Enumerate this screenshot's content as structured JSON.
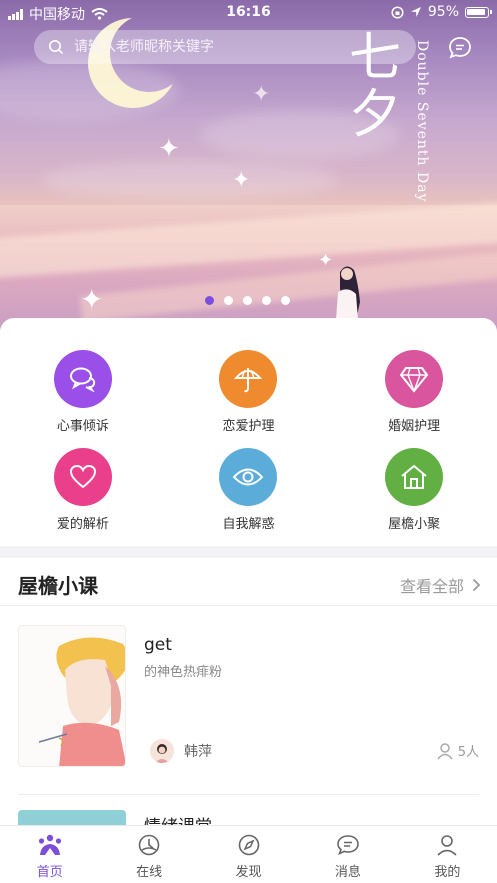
{
  "status_bar": {
    "carrier": "中国移动",
    "time": "16:16",
    "battery": "95%"
  },
  "search": {
    "placeholder": "请输入老师昵称关键字",
    "icon": "search-icon"
  },
  "banner": {
    "title_cn": "七夕",
    "title_en": "Double Seventh Day",
    "slide_count": 5,
    "active_slide": 1
  },
  "categories": [
    {
      "label": "心事倾诉",
      "icon": "chat-bubbles-icon",
      "color": "#9a4fe8"
    },
    {
      "label": "恋爱护理",
      "icon": "umbrella-icon",
      "color": "#f08a2e"
    },
    {
      "label": "婚姻护理",
      "icon": "diamond-icon",
      "color": "#d9559e"
    },
    {
      "label": "爱的解析",
      "icon": "heart-icon",
      "color": "#ea3f8a"
    },
    {
      "label": "自我解惑",
      "icon": "eye-icon",
      "color": "#5cacd9"
    },
    {
      "label": "屋檐小聚",
      "icon": "house-icon",
      "color": "#62b043"
    }
  ],
  "courses_section": {
    "title": "屋檐小课",
    "more_label": "查看全部"
  },
  "courses": [
    {
      "name": "get",
      "desc": "的神色热痱粉",
      "teacher": "韩萍",
      "count": "5人"
    },
    {
      "name": "情绪课堂",
      "desc": "",
      "teacher": "",
      "count": ""
    }
  ],
  "tabs": [
    {
      "label": "首页",
      "icon": "home-icon",
      "active": true
    },
    {
      "label": "在线",
      "icon": "online-icon",
      "active": false
    },
    {
      "label": "发现",
      "icon": "discover-icon",
      "active": false
    },
    {
      "label": "消息",
      "icon": "message-icon",
      "active": false
    },
    {
      "label": "我的",
      "icon": "profile-icon",
      "active": false
    }
  ],
  "colors": {
    "accent": "#7b4fd8",
    "active_dot": "#7a4fe0"
  }
}
